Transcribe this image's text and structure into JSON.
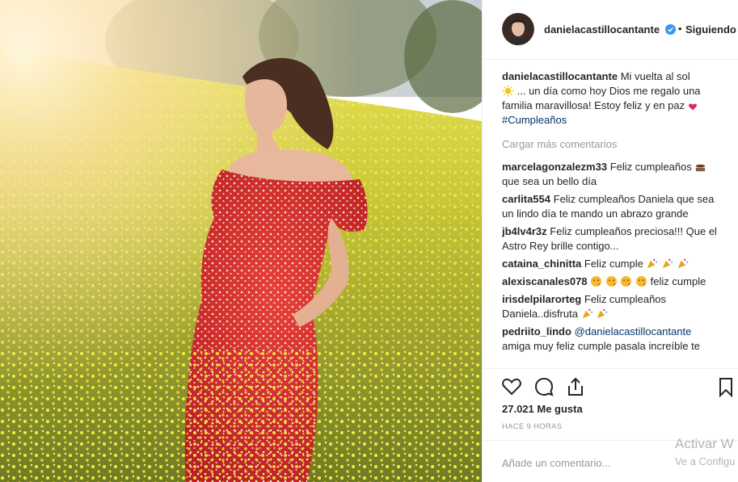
{
  "post": {
    "username": "danielacastillocantante",
    "separator": "•",
    "follow_status": "Siguiendo",
    "caption": {
      "username": "danielacastillocantante",
      "text_1": "Mi vuelta al sol",
      "text_2": "... un día como hoy Dios me regalo una familia maravillosa! Estoy feliz y en paz",
      "hashtag": "#Cumpleaños"
    },
    "load_more": "Cargar más comentarios",
    "comments": [
      {
        "user": "marcelagonzalezm33",
        "text": "Feliz cumpleaños",
        "text_2": "que sea un bello día"
      },
      {
        "user": "carlita554",
        "text": "Feliz cumpleaños Daniela que sea un lindo día te mando un abrazo grande"
      },
      {
        "user": "jb4lv4r3z",
        "text": "Feliz cumpleaños preciosa!!! Que el Astro Rey brille contigo..."
      },
      {
        "user": "cataina_chinitta",
        "text": "Feliz cumple"
      },
      {
        "user": "alexiscanales078",
        "text": "feliz cumple"
      },
      {
        "user": "irisdelpilarorteg",
        "text": "Feliz cumpleaños Daniela..disfruta"
      },
      {
        "user": "pedriito_lindo",
        "mention": "@danielacastillocantante",
        "text": "amiga muy feliz cumple pasala increíble te"
      }
    ],
    "likes": "27.021 Me gusta",
    "time": "HACE 9 HORAS",
    "add_comment_placeholder": "Añade un comentario...",
    "more_menu": "...",
    "icons": [
      "heart-icon",
      "comment-icon",
      "share-icon",
      "bookmark-icon",
      "verified-icon"
    ]
  },
  "os_overlay": {
    "activate": "Activar W",
    "activate_sub": "Ve a Configu"
  },
  "colors": {
    "link": "#003569",
    "muted": "#999999",
    "text": "#262626",
    "verified": "#3897f0"
  }
}
